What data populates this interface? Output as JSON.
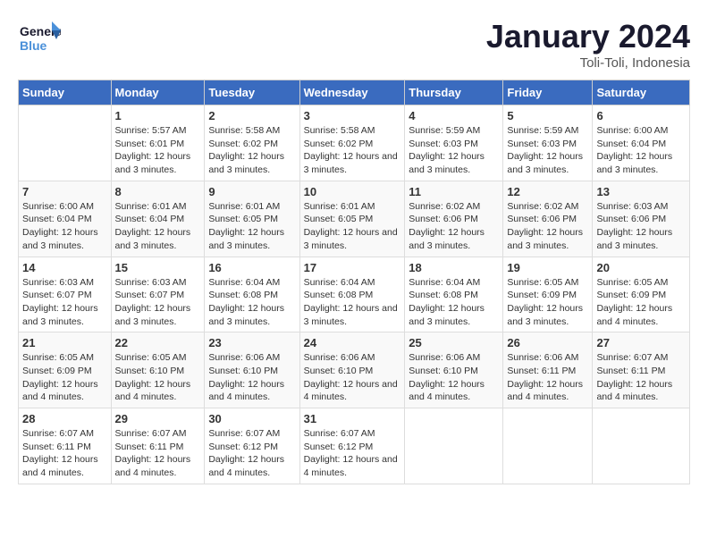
{
  "header": {
    "logo_general": "General",
    "logo_blue": "Blue",
    "title": "January 2024",
    "subtitle": "Toli-Toli, Indonesia"
  },
  "weekdays": [
    "Sunday",
    "Monday",
    "Tuesday",
    "Wednesday",
    "Thursday",
    "Friday",
    "Saturday"
  ],
  "weeks": [
    [
      {
        "day": "",
        "sunrise": "",
        "sunset": "",
        "daylight": ""
      },
      {
        "day": "1",
        "sunrise": "5:57 AM",
        "sunset": "6:01 PM",
        "daylight": "12 hours and 3 minutes."
      },
      {
        "day": "2",
        "sunrise": "5:58 AM",
        "sunset": "6:02 PM",
        "daylight": "12 hours and 3 minutes."
      },
      {
        "day": "3",
        "sunrise": "5:58 AM",
        "sunset": "6:02 PM",
        "daylight": "12 hours and 3 minutes."
      },
      {
        "day": "4",
        "sunrise": "5:59 AM",
        "sunset": "6:03 PM",
        "daylight": "12 hours and 3 minutes."
      },
      {
        "day": "5",
        "sunrise": "5:59 AM",
        "sunset": "6:03 PM",
        "daylight": "12 hours and 3 minutes."
      },
      {
        "day": "6",
        "sunrise": "6:00 AM",
        "sunset": "6:04 PM",
        "daylight": "12 hours and 3 minutes."
      }
    ],
    [
      {
        "day": "7",
        "sunrise": "6:00 AM",
        "sunset": "6:04 PM",
        "daylight": "12 hours and 3 minutes."
      },
      {
        "day": "8",
        "sunrise": "6:01 AM",
        "sunset": "6:04 PM",
        "daylight": "12 hours and 3 minutes."
      },
      {
        "day": "9",
        "sunrise": "6:01 AM",
        "sunset": "6:05 PM",
        "daylight": "12 hours and 3 minutes."
      },
      {
        "day": "10",
        "sunrise": "6:01 AM",
        "sunset": "6:05 PM",
        "daylight": "12 hours and 3 minutes."
      },
      {
        "day": "11",
        "sunrise": "6:02 AM",
        "sunset": "6:06 PM",
        "daylight": "12 hours and 3 minutes."
      },
      {
        "day": "12",
        "sunrise": "6:02 AM",
        "sunset": "6:06 PM",
        "daylight": "12 hours and 3 minutes."
      },
      {
        "day": "13",
        "sunrise": "6:03 AM",
        "sunset": "6:06 PM",
        "daylight": "12 hours and 3 minutes."
      }
    ],
    [
      {
        "day": "14",
        "sunrise": "6:03 AM",
        "sunset": "6:07 PM",
        "daylight": "12 hours and 3 minutes."
      },
      {
        "day": "15",
        "sunrise": "6:03 AM",
        "sunset": "6:07 PM",
        "daylight": "12 hours and 3 minutes."
      },
      {
        "day": "16",
        "sunrise": "6:04 AM",
        "sunset": "6:08 PM",
        "daylight": "12 hours and 3 minutes."
      },
      {
        "day": "17",
        "sunrise": "6:04 AM",
        "sunset": "6:08 PM",
        "daylight": "12 hours and 3 minutes."
      },
      {
        "day": "18",
        "sunrise": "6:04 AM",
        "sunset": "6:08 PM",
        "daylight": "12 hours and 3 minutes."
      },
      {
        "day": "19",
        "sunrise": "6:05 AM",
        "sunset": "6:09 PM",
        "daylight": "12 hours and 3 minutes."
      },
      {
        "day": "20",
        "sunrise": "6:05 AM",
        "sunset": "6:09 PM",
        "daylight": "12 hours and 4 minutes."
      }
    ],
    [
      {
        "day": "21",
        "sunrise": "6:05 AM",
        "sunset": "6:09 PM",
        "daylight": "12 hours and 4 minutes."
      },
      {
        "day": "22",
        "sunrise": "6:05 AM",
        "sunset": "6:10 PM",
        "daylight": "12 hours and 4 minutes."
      },
      {
        "day": "23",
        "sunrise": "6:06 AM",
        "sunset": "6:10 PM",
        "daylight": "12 hours and 4 minutes."
      },
      {
        "day": "24",
        "sunrise": "6:06 AM",
        "sunset": "6:10 PM",
        "daylight": "12 hours and 4 minutes."
      },
      {
        "day": "25",
        "sunrise": "6:06 AM",
        "sunset": "6:10 PM",
        "daylight": "12 hours and 4 minutes."
      },
      {
        "day": "26",
        "sunrise": "6:06 AM",
        "sunset": "6:11 PM",
        "daylight": "12 hours and 4 minutes."
      },
      {
        "day": "27",
        "sunrise": "6:07 AM",
        "sunset": "6:11 PM",
        "daylight": "12 hours and 4 minutes."
      }
    ],
    [
      {
        "day": "28",
        "sunrise": "6:07 AM",
        "sunset": "6:11 PM",
        "daylight": "12 hours and 4 minutes."
      },
      {
        "day": "29",
        "sunrise": "6:07 AM",
        "sunset": "6:11 PM",
        "daylight": "12 hours and 4 minutes."
      },
      {
        "day": "30",
        "sunrise": "6:07 AM",
        "sunset": "6:12 PM",
        "daylight": "12 hours and 4 minutes."
      },
      {
        "day": "31",
        "sunrise": "6:07 AM",
        "sunset": "6:12 PM",
        "daylight": "12 hours and 4 minutes."
      },
      {
        "day": "",
        "sunrise": "",
        "sunset": "",
        "daylight": ""
      },
      {
        "day": "",
        "sunrise": "",
        "sunset": "",
        "daylight": ""
      },
      {
        "day": "",
        "sunrise": "",
        "sunset": "",
        "daylight": ""
      }
    ]
  ]
}
